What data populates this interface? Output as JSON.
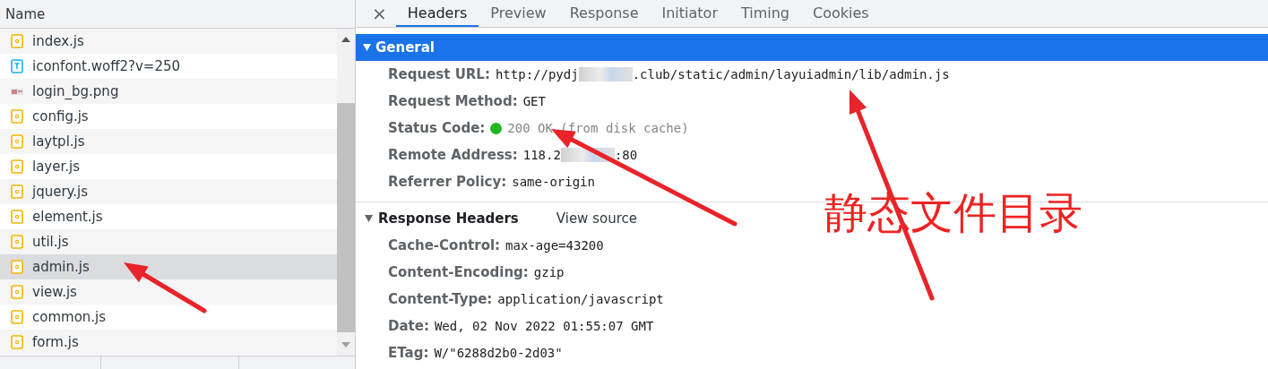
{
  "files": {
    "column": "Name",
    "rows": [
      {
        "name": "index.js",
        "kind": "script",
        "selected": false
      },
      {
        "name": "iconfont.woff2?v=250",
        "kind": "font",
        "selected": false
      },
      {
        "name": "login_bg.png",
        "kind": "image",
        "selected": false
      },
      {
        "name": "config.js",
        "kind": "script",
        "selected": false
      },
      {
        "name": "laytpl.js",
        "kind": "script",
        "selected": false
      },
      {
        "name": "layer.js",
        "kind": "script",
        "selected": false
      },
      {
        "name": "jquery.js",
        "kind": "script",
        "selected": false
      },
      {
        "name": "element.js",
        "kind": "script",
        "selected": false
      },
      {
        "name": "util.js",
        "kind": "script",
        "selected": false
      },
      {
        "name": "admin.js",
        "kind": "script",
        "selected": true
      },
      {
        "name": "view.js",
        "kind": "script",
        "selected": false
      },
      {
        "name": "common.js",
        "kind": "script",
        "selected": false
      },
      {
        "name": "form.js",
        "kind": "script",
        "selected": false
      }
    ]
  },
  "close": "×",
  "tabs": [
    {
      "label": "Headers",
      "selected": true
    },
    {
      "label": "Preview",
      "selected": false
    },
    {
      "label": "Response",
      "selected": false
    },
    {
      "label": "Initiator",
      "selected": false
    },
    {
      "label": "Timing",
      "selected": false
    },
    {
      "label": "Cookies",
      "selected": false
    }
  ],
  "general": {
    "title": "General",
    "expanded": true,
    "rows": [
      {
        "name": "Request URL:",
        "value_parts": [
          "http://pydj",
          ".club/static/admin/layuiadmin/lib/admin.js"
        ]
      },
      {
        "name": "Request Method:",
        "value_parts": [
          "GET"
        ]
      },
      {
        "name": "Status Code:",
        "value_parts": [
          "200 OK (from disk cache)"
        ],
        "color": "#22b722"
      },
      {
        "name": "Remote Address:",
        "value_parts": [
          "118.2",
          ":80"
        ]
      },
      {
        "name": "Referrer Policy:",
        "value_parts": [
          "same-origin"
        ]
      }
    ]
  },
  "response_headers": {
    "title": "Response Headers",
    "expanded": true,
    "link": "View source",
    "rows": [
      {
        "name": "Cache-Control:",
        "value": "max-age=43200"
      },
      {
        "name": "Content-Encoding:",
        "value": "gzip"
      },
      {
        "name": "Content-Type:",
        "value": "application/javascript"
      },
      {
        "name": "Date:",
        "value": "Wed, 02 Nov 2022 01:55:07 GMT"
      },
      {
        "name": "ETag:",
        "value": "W/\"6288d2b0-2d03\""
      }
    ]
  },
  "annotation": "静态文件目录"
}
